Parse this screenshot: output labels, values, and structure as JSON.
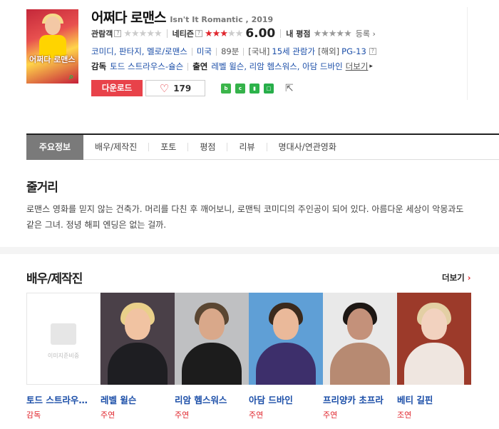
{
  "movie": {
    "poster_title": "어쩌다 로맨스",
    "title_ko": "어쩌다 로맨스",
    "title_en": "Isn't It Romantic , 2019"
  },
  "ratings": {
    "audience_label": "관람객",
    "netizen_label": "네티즌",
    "netizen_score": "6.00",
    "my_label": "내 평점",
    "register_label": "등록",
    "q": "?"
  },
  "info": {
    "genres": "코미디, 판타지, 멜로/로맨스",
    "country": "미국",
    "runtime": "89분",
    "kr_label": "[국내]",
    "kr_rating": "15세 관람가",
    "intl_label": "[해외]",
    "intl_rating": "PG-13"
  },
  "credits": {
    "director_label": "감독",
    "director": "토드 스트라우스-슐슨",
    "cast_label": "출연",
    "cast": "레벨 윌슨, 리암 헴스워스, 아담 드바인",
    "more": "더보기"
  },
  "actions": {
    "download": "다운로드",
    "likes": "179"
  },
  "share_icons": [
    "blog-icon",
    "cafe-icon",
    "bookmark-icon",
    "memo-icon"
  ],
  "tabs": [
    {
      "label": "주요정보"
    },
    {
      "label": "배우/제작진"
    },
    {
      "label": "포토"
    },
    {
      "label": "평점"
    },
    {
      "label": "리뷰"
    },
    {
      "label": "명대사/연관영화"
    }
  ],
  "story": {
    "heading": "줄거리",
    "line1": "로맨스 영화를 믿지 않는 건축가. 머리를 다친 후 깨어보니, 로맨틱 코미디의 주인공이 되어 있다. 아름다운 세상이 악몽과도",
    "line2": "같은 그녀. 정녕 해피 엔딩은 없는 걸까."
  },
  "staff": {
    "heading": "배우/제작진",
    "more": "더보기",
    "placeholder_text": "이미지준비중",
    "people": [
      {
        "name": "토드 스트라우…",
        "role": "감독"
      },
      {
        "name": "레벨 윌슨",
        "role": "주연"
      },
      {
        "name": "리암 헴스워스",
        "role": "주연"
      },
      {
        "name": "아담 드바인",
        "role": "주연"
      },
      {
        "name": "프리양카 초프라",
        "role": "주연"
      },
      {
        "name": "베티 길핀",
        "role": "조연"
      }
    ]
  },
  "colors": {
    "accent_red": "#e0262d",
    "link_blue": "#1b4ea8",
    "download_red": "#e8424a"
  }
}
